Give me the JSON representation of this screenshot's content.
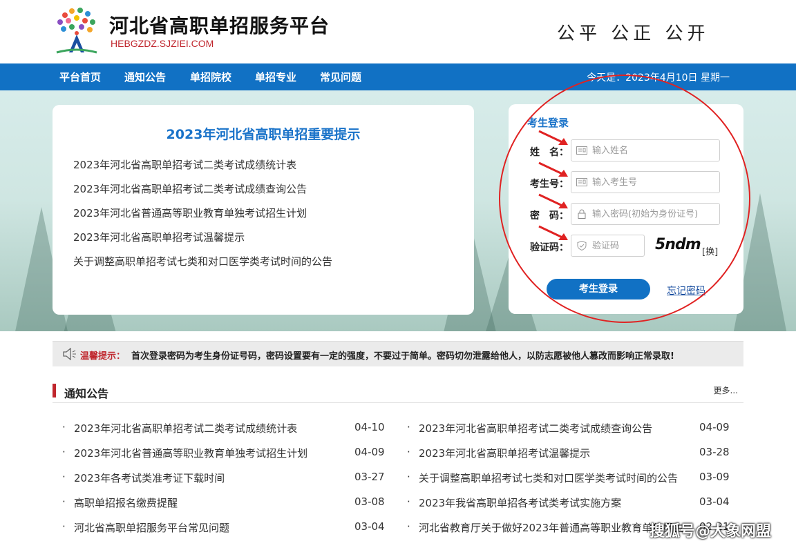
{
  "header": {
    "title": "河北省高职单招服务平台",
    "domain": "HEBGZDZ.SJZIEI.COM",
    "slogan": "公平 公正 公开"
  },
  "nav": {
    "items": [
      "平台首页",
      "通知公告",
      "单招院校",
      "单招专业",
      "常见问题"
    ],
    "today": "今天是：2023年4月10日 星期一"
  },
  "notice_card": {
    "title": "2023年河北省高职单招重要提示",
    "links": [
      "2023年河北省高职单招考试二类考试成绩统计表",
      "2023年河北省高职单招考试二类考试成绩查询公告",
      "2023年河北省普通高等职业教育单独考试招生计划",
      "2023年河北省高职单招考试温馨提示",
      "关于调整高职单招考试七类和对口医学类考试时间的公告"
    ]
  },
  "login": {
    "title": "考生登录",
    "name_label": "姓　名：",
    "name_placeholder": "输入姓名",
    "id_label": "考生号：",
    "id_placeholder": "输入考生号",
    "pwd_label": "密　码：",
    "pwd_placeholder": "输入密码(初始为身份证号)",
    "captcha_label": "验证码：",
    "captcha_placeholder": "验证码",
    "captcha_text": "5ndm",
    "refresh_label": "[换]",
    "submit_label": "考生登录",
    "forgot_label": "忘记密码"
  },
  "tip": {
    "label": "温馨提示：",
    "text": "首次登录密码为考生身份证号码，密码设置要有一定的强度，不要过于简单。密码切勿泄露给他人，以防志愿被他人篡改而影响正常录取!"
  },
  "notices": {
    "title": "通知公告",
    "more": "更多...",
    "items": [
      {
        "title": "2023年河北省高职单招考试二类考试成绩统计表",
        "date": "04-10"
      },
      {
        "title": "2023年河北省高职单招考试二类考试成绩查询公告",
        "date": "04-09"
      },
      {
        "title": "2023年河北省普通高等职业教育单独考试招生计划",
        "date": "04-09"
      },
      {
        "title": "2023年河北省高职单招考试温馨提示",
        "date": "03-28"
      },
      {
        "title": "2023年各考试类准考证下载时间",
        "date": "03-27"
      },
      {
        "title": "关于调整高职单招考试七类和对口医学类考试时间的公告",
        "date": "03-09"
      },
      {
        "title": "高职单招报名缴费提醒",
        "date": "03-08"
      },
      {
        "title": "2023年我省高职单招各考试类考试实施方案",
        "date": "03-04"
      },
      {
        "title": "河北省高职单招服务平台常见问题",
        "date": "03-04"
      },
      {
        "title": "河北省教育厅关于做好2023年普通高等职业教育单独招生",
        "date": "02-21"
      }
    ]
  },
  "watermark": "搜狐号@大象网盟",
  "colors": {
    "nav_blue": "#1171c4",
    "title_blue": "#1a73c9",
    "accent_red": "#c0262d",
    "annotation_red": "#e02222"
  }
}
